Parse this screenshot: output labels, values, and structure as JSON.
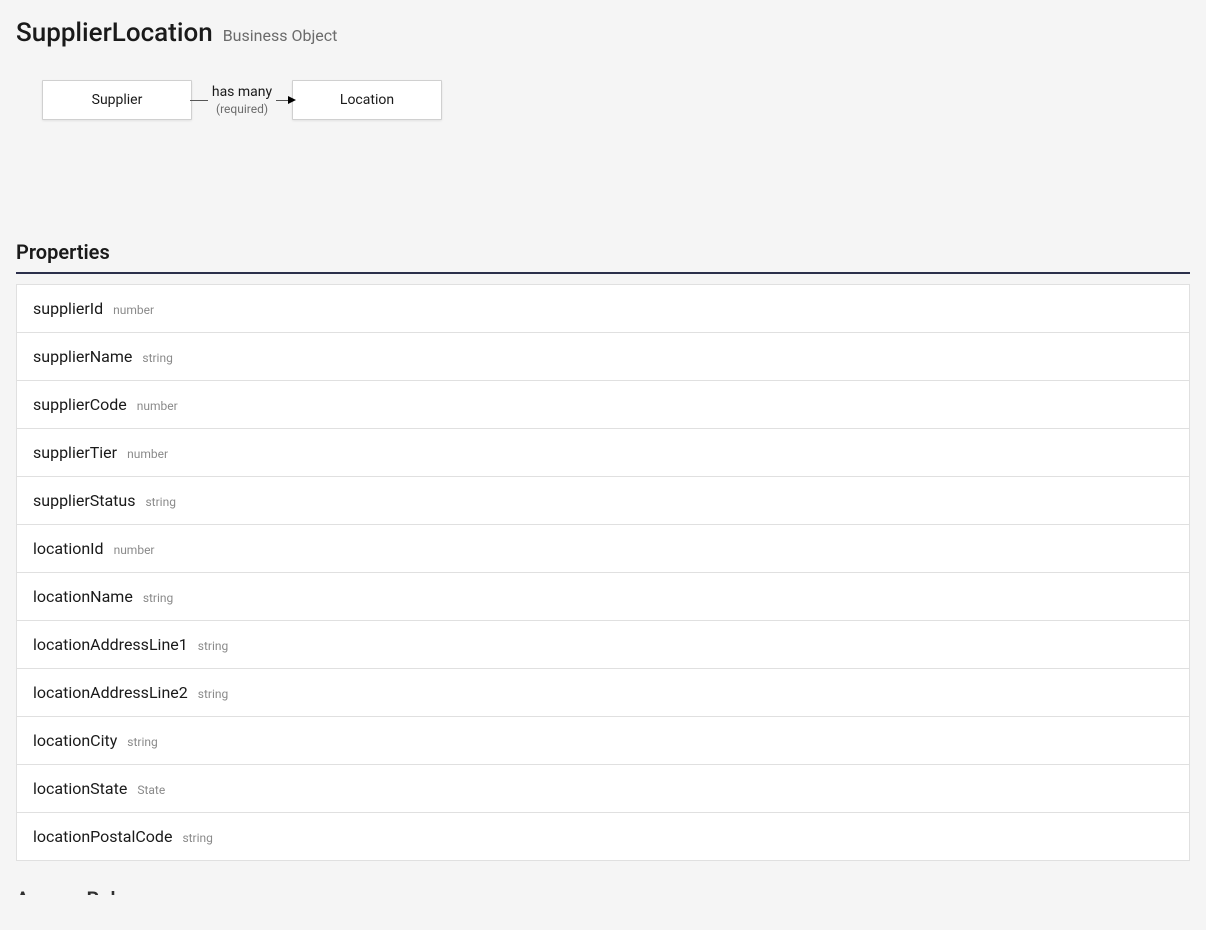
{
  "header": {
    "title": "SupplierLocation",
    "subtitle": "Business Object"
  },
  "diagram": {
    "entity_left": "Supplier",
    "entity_right": "Location",
    "relation_label": "has many",
    "relation_sub": "(required)"
  },
  "sections": {
    "properties_title": "Properties",
    "next_title": "Access Rules"
  },
  "properties": [
    {
      "name": "supplierId",
      "type": "number"
    },
    {
      "name": "supplierName",
      "type": "string"
    },
    {
      "name": "supplierCode",
      "type": "number"
    },
    {
      "name": "supplierTier",
      "type": "number"
    },
    {
      "name": "supplierStatus",
      "type": "string"
    },
    {
      "name": "locationId",
      "type": "number"
    },
    {
      "name": "locationName",
      "type": "string"
    },
    {
      "name": "locationAddressLine1",
      "type": "string"
    },
    {
      "name": "locationAddressLine2",
      "type": "string"
    },
    {
      "name": "locationCity",
      "type": "string"
    },
    {
      "name": "locationState",
      "type": "State"
    },
    {
      "name": "locationPostalCode",
      "type": "string"
    }
  ]
}
